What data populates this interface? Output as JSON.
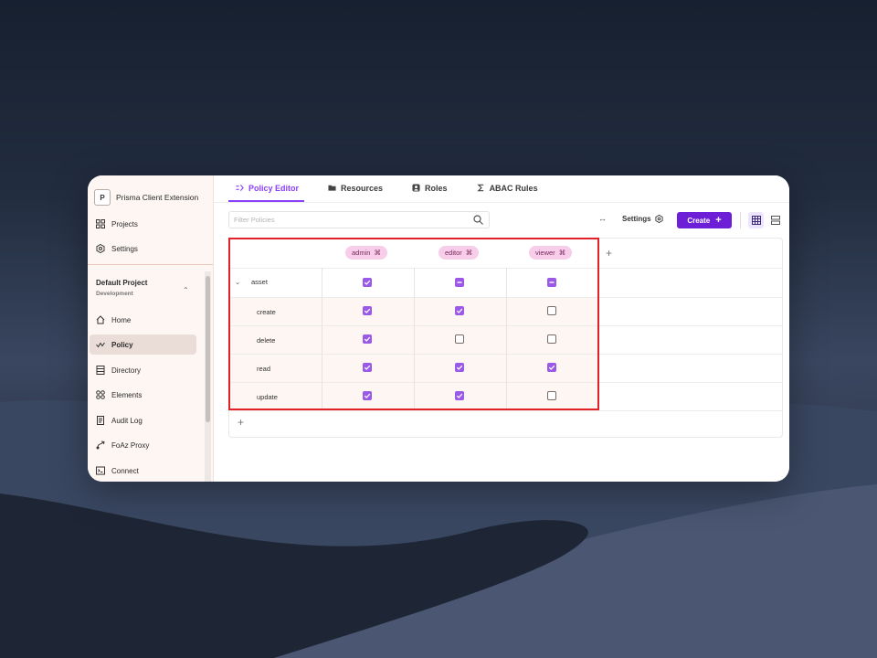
{
  "sidebar": {
    "workspace": {
      "logo": "P",
      "name": "Prisma Client Extension"
    },
    "top_items": [
      {
        "label": "Projects",
        "icon": "grid-icon"
      },
      {
        "label": "Settings",
        "icon": "gear-icon"
      }
    ],
    "project": {
      "name": "Default Project",
      "env": "Development"
    },
    "items": [
      {
        "label": "Home",
        "icon": "home-icon"
      },
      {
        "label": "Policy",
        "icon": "policy-icon",
        "active": true
      },
      {
        "label": "Directory",
        "icon": "directory-icon"
      },
      {
        "label": "Elements",
        "icon": "elements-icon"
      },
      {
        "label": "Audit Log",
        "icon": "audit-log-icon"
      },
      {
        "label": "FoAz Proxy",
        "icon": "proxy-icon"
      },
      {
        "label": "Connect",
        "icon": "terminal-icon"
      }
    ]
  },
  "tabs": [
    {
      "label": "Policy Editor",
      "icon": "policy-editor-icon",
      "active": true
    },
    {
      "label": "Resources",
      "icon": "folder-icon"
    },
    {
      "label": "Roles",
      "icon": "roles-icon"
    },
    {
      "label": "ABAC Rules",
      "icon": "sigma-icon"
    }
  ],
  "toolbar": {
    "filter_placeholder": "Filter Policies",
    "arrows": "↔",
    "settings_label": "Settings",
    "create_label": "Create"
  },
  "table": {
    "roles": [
      "admin",
      "editor",
      "viewer"
    ],
    "resource": "asset",
    "resource_state": [
      "on",
      "ind",
      "ind"
    ],
    "actions": [
      {
        "name": "create",
        "perms": [
          true,
          true,
          false
        ]
      },
      {
        "name": "delete",
        "perms": [
          true,
          false,
          false
        ]
      },
      {
        "name": "read",
        "perms": [
          true,
          true,
          true
        ]
      },
      {
        "name": "update",
        "perms": [
          true,
          true,
          false
        ]
      }
    ]
  },
  "colors": {
    "accent": "#6d1fd7",
    "checkbox": "#9b59e8",
    "role_pill": "#f7cdea",
    "highlight": "#e2202a"
  }
}
